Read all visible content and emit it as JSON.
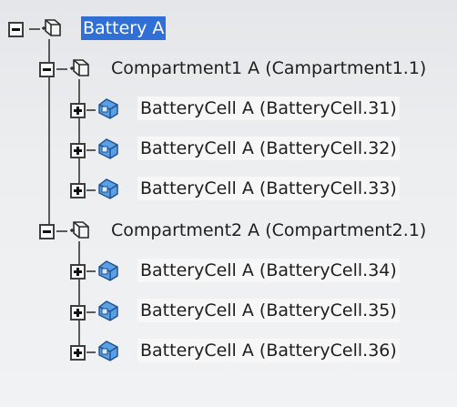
{
  "tree": {
    "root": {
      "label": "Battery A",
      "icon": "product-icon",
      "expanded": true,
      "selected": true
    },
    "compartments": [
      {
        "label": "Compartment1 A (Campartment1.1)",
        "icon": "product-icon",
        "expanded": true,
        "cells": [
          {
            "label": "BatteryCell A (BatteryCell.31)",
            "icon": "part-icon",
            "expanded": false
          },
          {
            "label": "BatteryCell A (BatteryCell.32)",
            "icon": "part-icon",
            "expanded": false
          },
          {
            "label": "BatteryCell A (BatteryCell.33)",
            "icon": "part-icon",
            "expanded": false
          }
        ]
      },
      {
        "label": "Compartment2 A (Compartment2.1)",
        "icon": "product-icon",
        "expanded": true,
        "cells": [
          {
            "label": "BatteryCell A (BatteryCell.34)",
            "icon": "part-icon",
            "expanded": false
          },
          {
            "label": "BatteryCell A (BatteryCell.35)",
            "icon": "part-icon",
            "expanded": false
          },
          {
            "label": "BatteryCell A (BatteryCell.36)",
            "icon": "part-icon",
            "expanded": false
          }
        ]
      }
    ]
  },
  "colors": {
    "selection": "#2f6fd6",
    "connector": "#5a5a5a",
    "part_icon": "#4a90d9"
  }
}
